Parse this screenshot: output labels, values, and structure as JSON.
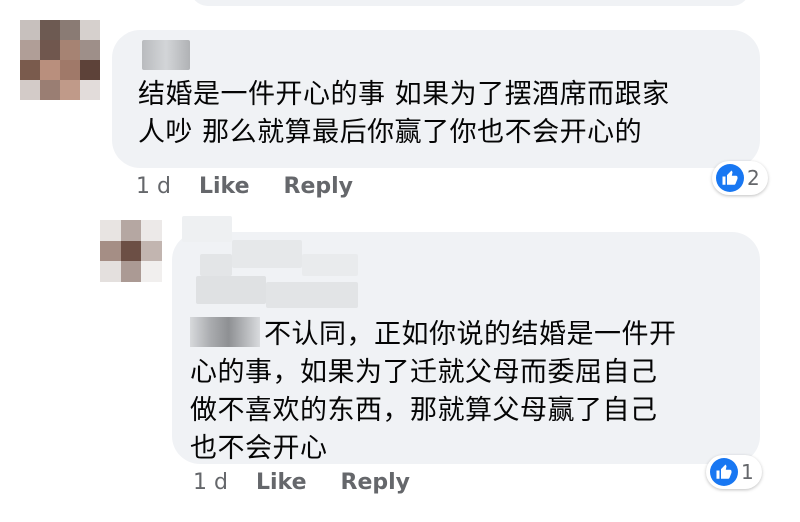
{
  "comments": [
    {
      "text_line1": "结婚是一件开心的事 如果为了摆酒席而跟家",
      "text_line2": "人吵 那么就算最后你赢了你也不会开心的",
      "time": "1 d",
      "like_label": "Like",
      "reply_label": "Reply",
      "reaction_count": "2",
      "reaction_icon": "thumbs-up-icon"
    },
    {
      "text_line1": "不认同，正如你说的结婚是一件开",
      "text_line2": "心的事，如果为了迁就父母而委屈自己",
      "text_line3": "做不喜欢的东西，那就算父母赢了自己",
      "text_line4": "也不会开心",
      "time": "1 d",
      "like_label": "Like",
      "reply_label": "Reply",
      "reaction_count": "1",
      "reaction_icon": "thumbs-up-icon"
    }
  ],
  "colors": {
    "bubble": "#f0f2f5",
    "meta_text": "#65676b",
    "like_blue": "#1877f2"
  }
}
